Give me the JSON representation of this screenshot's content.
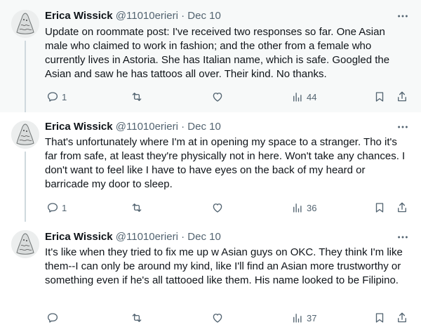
{
  "tweets": [
    {
      "name": "Erica Wissick",
      "handle": "@11010erieri",
      "separator": "·",
      "date": "Dec 10",
      "text": "Update on roommate post: I've received two responses so far. One Asian male who claimed to work in fashion; and the other from a female who currently lives in Astoria. She has Italian name, which is safe. Googled the Asian and saw he has tattoos all over. Their kind. No thanks.",
      "replies": "1",
      "retweets": "",
      "likes": "",
      "views": "44"
    },
    {
      "name": "Erica Wissick",
      "handle": "@11010erieri",
      "separator": "·",
      "date": "Dec 10",
      "text": "That's unfortunately where I'm at in opening my space to a stranger. Tho it's far from safe, at least they're physically not in here. Won't take any chances. I don't want to feel like I have to have eyes on the back of my heard or barricade my door to sleep.",
      "replies": "1",
      "retweets": "",
      "likes": "",
      "views": "36"
    },
    {
      "name": "Erica Wissick",
      "handle": "@11010erieri",
      "separator": "·",
      "date": "Dec 10",
      "text": "It's like when they tried to fix me up w Asian guys on OKC. They think I'm like them--I can only be around my kind, like I'll find an Asian more trustworthy or something even if he's all tattooed like them. His name looked to be Filipino.",
      "replies": "",
      "retweets": "",
      "likes": "",
      "views": "37"
    }
  ],
  "colors": {
    "text": "#0f1419",
    "muted": "#536471",
    "thread_line": "#cfd9de",
    "highlight_bg": "#f7f9f9"
  },
  "icons": {
    "reply": "reply-icon",
    "retweet": "retweet-icon",
    "like": "heart-icon",
    "views": "views-icon",
    "bookmark": "bookmark-icon",
    "share": "share-icon",
    "more": "more-icon"
  }
}
